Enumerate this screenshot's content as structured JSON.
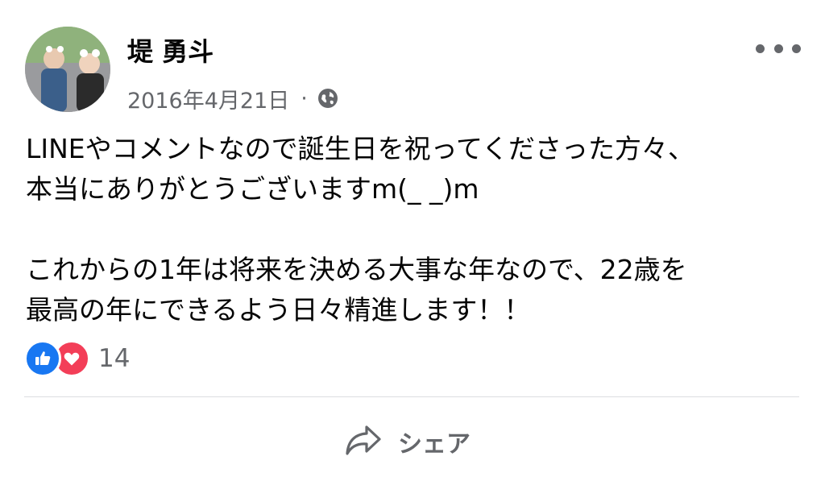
{
  "post": {
    "author_name": "堤 勇斗",
    "date": "2016年4月21日",
    "separator": "·",
    "privacy_icon": "globe-icon",
    "more_icon": "more-horizontal-icon",
    "body": {
      "line1": "LINEやコメントなので誕生日を祝ってくださった方々、",
      "line2": "本当にありがとうございますm(_ _)m",
      "line3": "これからの1年は将来を決める大事な年なので、22歳を",
      "line4": "最高の年にできるよう日々精進します！！"
    },
    "reactions": {
      "icons": [
        "like-icon",
        "love-icon"
      ],
      "count": "14"
    },
    "actions": {
      "share_label": "シェア",
      "share_icon": "share-arrow-icon"
    },
    "colors": {
      "like": "#1877f2",
      "love": "#f33e58",
      "secondary_text": "#65676b"
    }
  }
}
